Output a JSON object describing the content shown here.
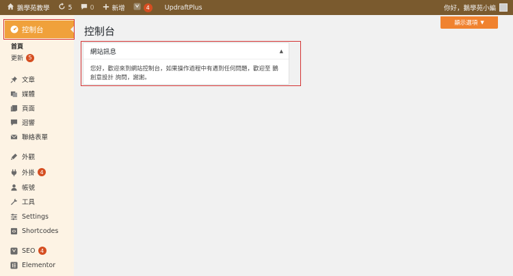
{
  "adminbar": {
    "site_name": "鵝學苑教學",
    "updates_count": "5",
    "comments_count": "0",
    "new_label": "新增",
    "seo_badge": "4",
    "plugin_label": "UpdraftPlus",
    "greeting": "你好，鵝學苑小編"
  },
  "sidebar": {
    "dashboard_label": "控制台",
    "sub_home": "首頁",
    "sub_updates": "更新",
    "sub_updates_badge": "5",
    "items": [
      {
        "label": "文章",
        "icon": "pin-icon"
      },
      {
        "label": "媒體",
        "icon": "media-icon"
      },
      {
        "label": "頁面",
        "icon": "pages-icon"
      },
      {
        "label": "迴響",
        "icon": "comments-icon"
      },
      {
        "label": "聯絡表單",
        "icon": "mail-icon"
      },
      {
        "label": "外觀",
        "icon": "appearance-icon"
      },
      {
        "label": "外掛",
        "icon": "plugins-icon",
        "badge": "4"
      },
      {
        "label": "帳號",
        "icon": "users-icon"
      },
      {
        "label": "工具",
        "icon": "tools-icon"
      },
      {
        "label": "Settings",
        "icon": "settings-icon"
      },
      {
        "label": "Shortcodes",
        "icon": "shortcodes-icon"
      },
      {
        "label": "SEO",
        "icon": "seo-icon",
        "badge": "4"
      },
      {
        "label": "Elementor",
        "icon": "elementor-icon"
      }
    ]
  },
  "main": {
    "screen_options": "顯示選項",
    "title": "控制台",
    "widget": {
      "title": "網站訊息",
      "body_text": "您好，歡迎來到網站控制台，如果操作過程中有遇到任何問題，歡迎至",
      "link1": "鵝創意設計",
      "body_after_link": "詢問，謝謝。"
    }
  },
  "colors": {
    "adminbar": "#7a5a2e",
    "accent": "#f0a13b",
    "sidebar": "#fdf3e4",
    "badge": "#d54e21",
    "highlight": "#d32f2f"
  }
}
